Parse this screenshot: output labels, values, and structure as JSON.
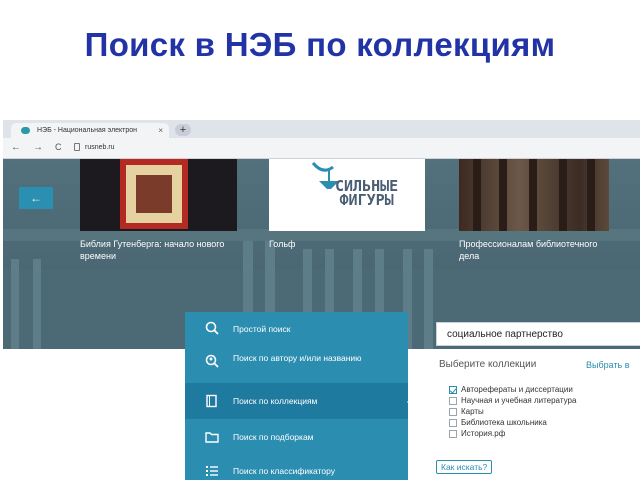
{
  "slide": {
    "title": "Поиск в НЭБ по коллекциям"
  },
  "browser": {
    "tab_title": "НЭБ - Национальная электрон",
    "tab_close": "×",
    "new_tab": "+",
    "back": "←",
    "forward": "→",
    "reload": "C",
    "url": "rusneb.ru"
  },
  "carousel": {
    "back_button": "←",
    "cards": [
      {
        "title": "Библия Гутенберга: начало нового времени"
      },
      {
        "title": "Гольф",
        "logo_line1": "СИЛЬНЫЕ",
        "logo_line2": "ФИГУРЫ"
      },
      {
        "title": "Профессионалам библиотечного дела"
      }
    ]
  },
  "search_menu": {
    "items": [
      {
        "label": "Простой поиск",
        "icon": "magnifier-icon"
      },
      {
        "label": "Поиск по автору и/или названию",
        "icon": "author-search-icon"
      },
      {
        "label": "Поиск по коллекциям",
        "icon": "book-icon",
        "active": true
      },
      {
        "label": "Поиск по подборкам",
        "icon": "folder-icon"
      },
      {
        "label": "Поиск по классификатору",
        "icon": "list-icon"
      }
    ]
  },
  "search_panel": {
    "query": "социальное партнерство",
    "choose_label": "Выберите коллекции",
    "choose_all": "Выбрать в",
    "collections": [
      {
        "label": "Авторефераты и диссертации",
        "checked": true
      },
      {
        "label": "Научная и учебная литература",
        "checked": false
      },
      {
        "label": "Карты",
        "checked": false
      },
      {
        "label": "Библиотека школьника",
        "checked": false
      },
      {
        "label": "История.рф",
        "checked": false
      }
    ],
    "how_to_search": "Как искать?"
  },
  "colors": {
    "title": "#2233a6",
    "accent": "#2b8db0",
    "active": "#1f7aa0"
  }
}
